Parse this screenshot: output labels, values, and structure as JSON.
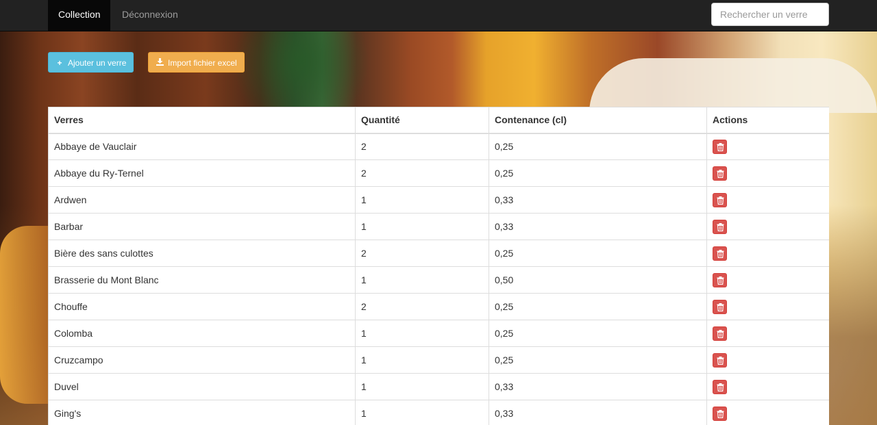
{
  "navbar": {
    "active_tab": "Collection",
    "logout_link": "Déconnexion",
    "search_placeholder": "Rechercher un verre"
  },
  "toolbar": {
    "add_label": "Ajouter un verre",
    "import_label": "Import fichier excel"
  },
  "colors": {
    "add_button": "#5bc0de",
    "import_button": "#f0ad4e",
    "delete_button": "#d9534f"
  },
  "table": {
    "headers": [
      "Verres",
      "Quantité",
      "Contenance (cl)",
      "Actions"
    ],
    "rows": [
      {
        "name": "Abbaye de Vauclair",
        "qty": "2",
        "cap": "0,25"
      },
      {
        "name": "Abbaye du Ry-Ternel",
        "qty": "2",
        "cap": "0,25"
      },
      {
        "name": "Ardwen",
        "qty": "1",
        "cap": "0,33"
      },
      {
        "name": "Barbar",
        "qty": "1",
        "cap": "0,33"
      },
      {
        "name": "Bière des sans culottes",
        "qty": "2",
        "cap": "0,25"
      },
      {
        "name": "Brasserie du Mont Blanc",
        "qty": "1",
        "cap": "0,50"
      },
      {
        "name": "Chouffe",
        "qty": "2",
        "cap": "0,25"
      },
      {
        "name": "Colomba",
        "qty": "1",
        "cap": "0,25"
      },
      {
        "name": "Cruzcampo",
        "qty": "1",
        "cap": "0,25"
      },
      {
        "name": "Duvel",
        "qty": "1",
        "cap": "0,33"
      },
      {
        "name": "Ging's",
        "qty": "1",
        "cap": "0,33"
      }
    ],
    "action_icon": "trash-icon"
  }
}
